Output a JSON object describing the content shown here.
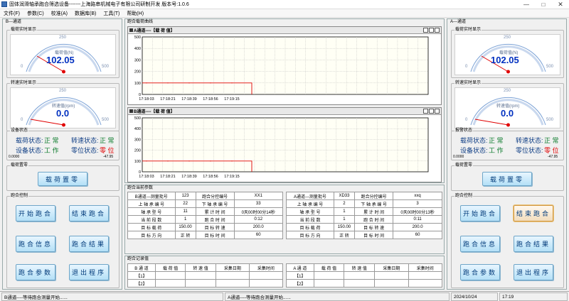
{
  "window": {
    "title": "固体润滑轴承跑合筛选设备-------上海路串机械电子有限公司研制开发  版本号:1.0.6"
  },
  "menu": [
    "文件(F)",
    "参数(C)",
    "校准(A)",
    "数据库(B)",
    "工具(T)",
    "帮助(H)"
  ],
  "left": {
    "title": "B---通道",
    "load_display": {
      "label": "载荷实时显示",
      "gauge_label": "载荷值(N)",
      "value": "102.05",
      "scale": [
        "0",
        "250",
        "500"
      ],
      "fraction": 0.2
    },
    "speed_display": {
      "label": "转速实时显示",
      "gauge_label": "转速值(rpm)",
      "value": "0.0",
      "scale": [
        "0",
        "250",
        "500"
      ],
      "fraction": 0.0
    },
    "device_status": {
      "label": "设备状态",
      "row1": [
        "载荷状态:",
        "正 常",
        "转速状态:",
        "正 常"
      ],
      "row2": [
        "设备状态:",
        "工 作",
        "零位状态:",
        "零 位"
      ],
      "left_num": "0.0000",
      "right_num": "-47.95"
    },
    "zero": {
      "label": "载荷置零",
      "button": "载荷置零"
    },
    "control": {
      "label": "跑合控制",
      "buttons": [
        "开始跑合",
        "结束跑合",
        "跑合信息",
        "跑合结果",
        "跑合参数",
        "退出程序"
      ]
    }
  },
  "right": {
    "title": "A---通道",
    "load_display": {
      "label": "载荷实时显示",
      "gauge_label": "载荷值(N)",
      "value": "102.05",
      "scale": [
        "0",
        "250",
        "500"
      ],
      "fraction": 0.2
    },
    "speed_display": {
      "label": "转速实时显示",
      "gauge_label": "转速值(rpm)",
      "value": "0.0",
      "scale": [
        "0",
        "250",
        "500"
      ],
      "fraction": 0.0
    },
    "device_status": {
      "label": "报警状态",
      "row1": [
        "载荷状态:",
        "正 常",
        "转速状态:",
        "正 常"
      ],
      "row2": [
        "设备状态:",
        "工 作",
        "零位状态:",
        "零 位"
      ],
      "left_num": "0.0000",
      "right_num": "-47.95"
    },
    "zero": {
      "label": "载荷置零",
      "button": "载荷置零"
    },
    "control": {
      "label": "跑合控制",
      "buttons": [
        "开始跑合",
        "结束跑合",
        "跑合信息",
        "跑合结果",
        "跑合参数",
        "退出程序"
      ]
    }
  },
  "center": {
    "curve_title": "跑合载荷曲线",
    "chart_data": [
      {
        "type": "line",
        "title": "A通道----【载 荷 值】",
        "x": [
          "17:18:03",
          "17:18:21",
          "17:18:39",
          "17:18:56",
          "17:19:15"
        ],
        "ylim": [
          0,
          500
        ],
        "yticks": [
          "500",
          "400",
          "300",
          "200",
          "100",
          "0"
        ],
        "series": [
          {
            "values": [
              100,
              100,
              100,
              100,
              100
            ]
          }
        ],
        "grid": true
      },
      {
        "type": "line",
        "title": "B通道----【载 荷 值】",
        "x": [
          "17:18:03",
          "17:18:21",
          "17:18:39",
          "17:18:56",
          "17:19:15"
        ],
        "ylim": [
          0,
          500
        ],
        "yticks": [
          "500",
          "400",
          "300",
          "200",
          "100",
          "0"
        ],
        "series": [
          {
            "values": [
              100,
              100,
              100,
              100,
              100
            ]
          }
        ],
        "grid": true
      }
    ],
    "params_title": "跑合当前参数",
    "params_left": [
      [
        "B通道---测量批号",
        "123",
        "跑合分控编号",
        "XX1"
      ],
      [
        "上 轴 承 编 号",
        "22",
        "下 轴 承 编 号",
        "33"
      ],
      [
        "轴 承 型 号",
        "11",
        "累 计 时 间",
        "0天00时00分14秒"
      ],
      [
        "当 前 段 数",
        "1",
        "跑 合 时 间",
        "0:12"
      ],
      [
        "目 标 载 荷",
        "150.00",
        "目 标 转 速",
        "200.0"
      ],
      [
        "目 标 方 向",
        "正  转",
        "目 标 时 间",
        "60"
      ]
    ],
    "params_right": [
      [
        "A通道---测量批号",
        "XD33",
        "跑合分控编号",
        "xxq"
      ],
      [
        "上 轴 承 编 号",
        "2",
        "下 轴 承 编 号",
        "3"
      ],
      [
        "轴 承 型 号",
        "1",
        "累 计 时 间",
        "0天00时00分13秒"
      ],
      [
        "当 前 段 数",
        "1",
        "跑 合 时 间",
        "0:11"
      ],
      [
        "目 标 载 荷",
        "150.00",
        "目 标 转 速",
        "200.0"
      ],
      [
        "目 标 方 向",
        "正  转",
        "目 标 时 间",
        "60"
      ]
    ],
    "record_title": "跑合记录值",
    "record_left": {
      "headers": [
        "B 通 道",
        "载 荷 值",
        "转 速 值",
        "采集日期",
        "采集时间"
      ],
      "rows": [
        [
          "【1】",
          "",
          "",
          "",
          ""
        ],
        [
          "【2】",
          "",
          "",
          "",
          ""
        ]
      ]
    },
    "record_right": {
      "headers": [
        "A 通 道",
        "载 荷 值",
        "转 速 值",
        "采集日期",
        "采集时间"
      ],
      "rows": [
        [
          "【1】",
          "",
          "",
          "",
          ""
        ],
        [
          "【2】",
          "",
          "",
          "",
          ""
        ]
      ]
    }
  },
  "status": {
    "b_msg": "B通道----等待跑合测量开始......",
    "a_msg": "A通道----等待跑合测量开始......",
    "date": "2024/10/24",
    "time": "17:19"
  },
  "colors": {
    "button_text": "#003a7a",
    "status_ok": "#0a7a2a",
    "status_alarm": "#e00000",
    "value": "#0030c0",
    "chart_line": "#e00000"
  }
}
